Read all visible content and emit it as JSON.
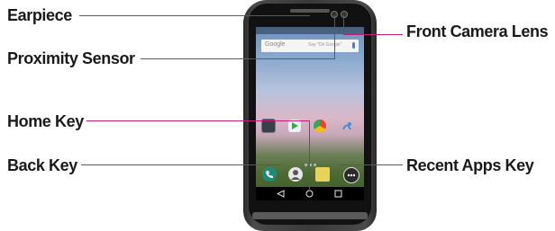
{
  "labels": {
    "earpiece": "Earpiece",
    "proximity_sensor": "Proximity Sensor",
    "home_key": "Home Key",
    "back_key": "Back Key",
    "front_camera_lens": "Front Camera Lens",
    "recent_apps_key": "Recent Apps Key"
  },
  "screen": {
    "search_logo": "Google",
    "search_hint": "Say \"Ok Google\""
  },
  "colors": {
    "callout_line": "#c21e7a",
    "label_text": "#1a1a1a"
  },
  "icons": [
    "earpiece-icon",
    "proximity-sensor-icon",
    "front-camera-icon",
    "back-icon",
    "home-icon",
    "recent-apps-icon"
  ]
}
